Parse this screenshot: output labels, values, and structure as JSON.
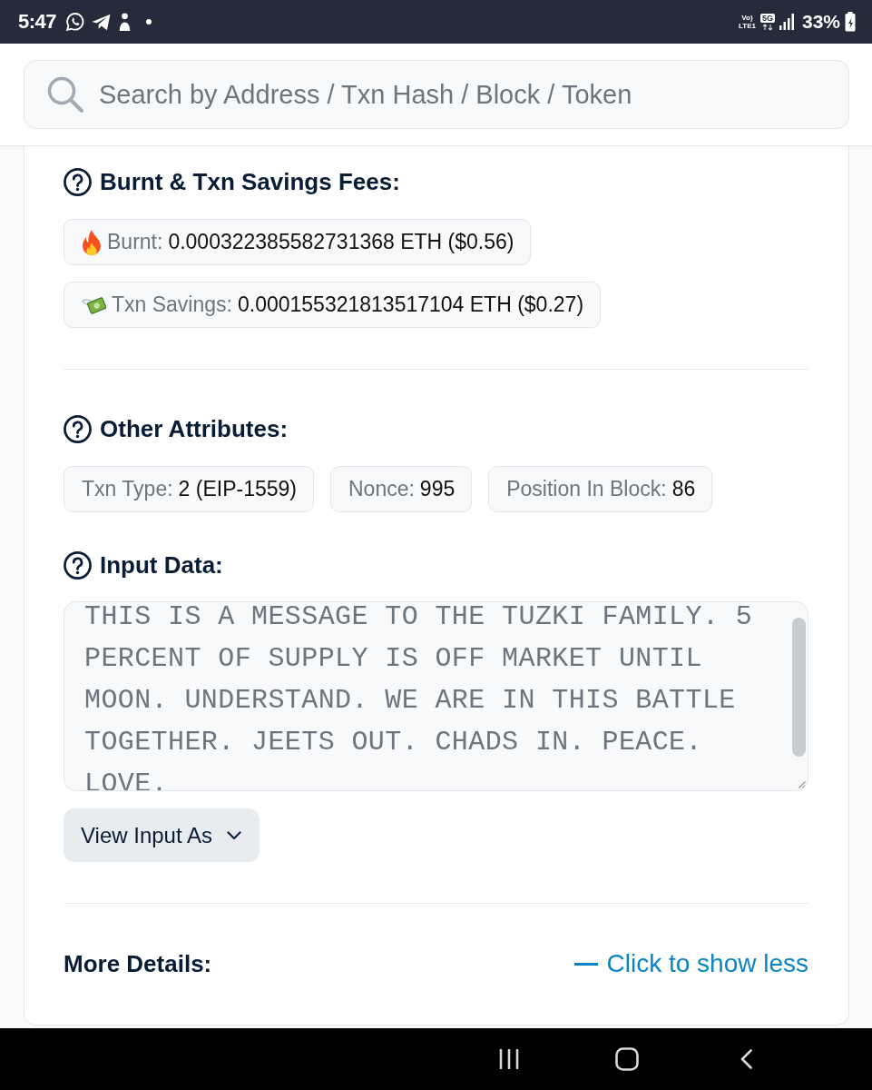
{
  "status_bar": {
    "time": "5:47",
    "volte": "Vo)",
    "lte": "LTE1",
    "network": "5G",
    "battery": "33%",
    "charging": true
  },
  "search": {
    "placeholder": "Search by Address / Txn Hash / Block / Token"
  },
  "fees": {
    "title": "Burnt & Txn Savings Fees:",
    "items": [
      {
        "kind": "burnt",
        "label": "Burnt:",
        "value": "0.000322385582731368 ETH ($0.56)"
      },
      {
        "kind": "savings",
        "label": "Txn Savings:",
        "value": "0.000155321813517104 ETH ($0.27)"
      }
    ]
  },
  "attributes": {
    "title": "Other Attributes:",
    "items": [
      {
        "label": "Txn Type:",
        "value": "2 (EIP-1559)"
      },
      {
        "label": "Nonce:",
        "value": "995"
      },
      {
        "label": "Position In Block:",
        "value": "86"
      }
    ]
  },
  "input_data": {
    "title": "Input Data:",
    "text": "THIS IS A MESSAGE TO THE TUZKI FAMILY. 5 PERCENT OF SUPPLY IS OFF MARKET UNTIL MOON. UNDERSTAND. WE ARE IN THIS BATTLE TOGETHER. JEETS OUT. CHADS IN. PEACE. LOVE.",
    "button": "View Input As"
  },
  "more_details": {
    "title": "More Details:",
    "toggle": "Click to show less",
    "expanded": true
  }
}
